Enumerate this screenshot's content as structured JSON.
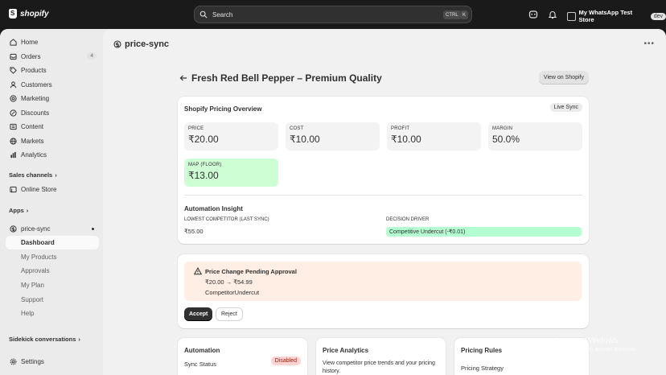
{
  "topbar": {
    "brand": "shopify",
    "search_placeholder": "Search",
    "shortcut_ctrl": "CTRL",
    "shortcut_key": "K",
    "store_name": "My WhatsApp Test Store",
    "store_badge": "dev"
  },
  "sidebar": {
    "items": [
      {
        "label": "Home",
        "icon": "home-icon"
      },
      {
        "label": "Orders",
        "icon": "orders-icon",
        "badge": "4"
      },
      {
        "label": "Products",
        "icon": "tag-icon"
      },
      {
        "label": "Customers",
        "icon": "person-icon"
      },
      {
        "label": "Marketing",
        "icon": "target-icon"
      },
      {
        "label": "Discounts",
        "icon": "discount-icon"
      },
      {
        "label": "Content",
        "icon": "content-icon"
      },
      {
        "label": "Markets",
        "icon": "globe-icon"
      },
      {
        "label": "Analytics",
        "icon": "chart-icon"
      }
    ],
    "sales_channels_label": "Sales channels",
    "online_store_label": "Online Store",
    "apps_label": "Apps",
    "app_name": "price-sync",
    "app_subitems": [
      "Dashboard",
      "My Products",
      "Approvals",
      "My Plan",
      "Support",
      "Help"
    ],
    "sidekick_label": "Sidekick conversations",
    "settings_label": "Settings"
  },
  "app_header": {
    "title": "price-sync"
  },
  "page": {
    "title": "Fresh Red Bell Pepper – Premium Quality",
    "view_button": "View on Shopify"
  },
  "overview": {
    "title": "Shopify Pricing Overview",
    "badge": "Live Sync",
    "metrics": [
      {
        "label": "PRICE",
        "value": "₹20.00"
      },
      {
        "label": "COST",
        "value": "₹10.00"
      },
      {
        "label": "PROFIT",
        "value": "₹10.00"
      },
      {
        "label": "MARGIN",
        "value": "50.0%"
      }
    ],
    "map": {
      "label": "MAP (FLOOR)",
      "value": "₹13.00"
    },
    "insight_title": "Automation Insight",
    "lowest_label": "LOWEST COMPETITOR (LAST SYNC)",
    "lowest_value": "₹55.00",
    "driver_label": "DECISION DRIVER",
    "driver_value": "Competitive Undercut (-₹0.01)"
  },
  "approval": {
    "title": "Price Change Pending Approval",
    "change": "₹20.00 → ₹54.99",
    "reason": "CompetitorUndercut",
    "accept_label": "Accept",
    "reject_label": "Reject"
  },
  "automation": {
    "title": "Automation",
    "sync_label": "Sync Status",
    "sync_badge": "Disabled"
  },
  "analytics": {
    "title": "Price Analytics",
    "desc": "View competitor price trends and your pricing history."
  },
  "rules": {
    "title": "Pricing Rules",
    "strategy_label": "Pricing Strategy"
  },
  "watermark": {
    "line1": "Activate Windows",
    "line2": "Go to Settings to activate Windows."
  }
}
